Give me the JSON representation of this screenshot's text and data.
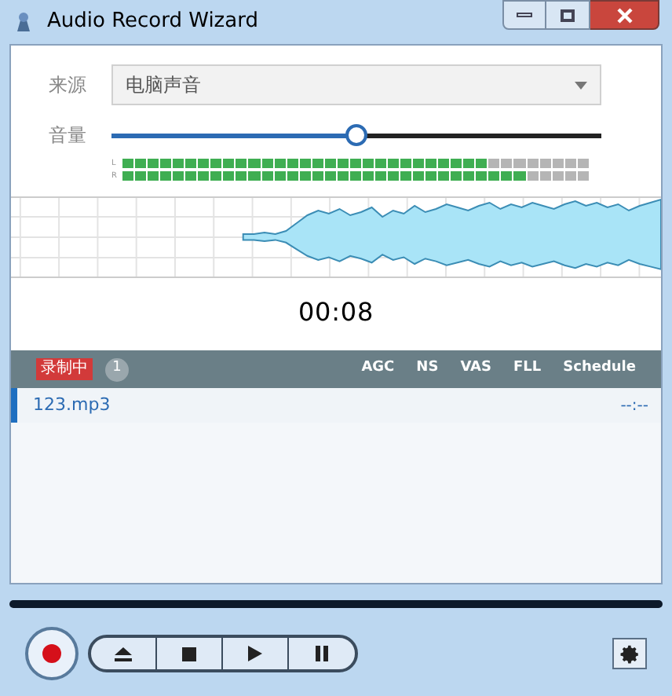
{
  "window": {
    "title": "Audio Record Wizard"
  },
  "source": {
    "label": "来源",
    "value": "电脑声音"
  },
  "volume": {
    "label": "音量",
    "level": 0.5
  },
  "meters": [
    {
      "channel": "L",
      "level": 0.78
    },
    {
      "channel": "R",
      "level": 0.86
    }
  ],
  "time": "00:08",
  "status_bar": {
    "state": "录制中",
    "count": "1",
    "options": [
      "AGC",
      "NS",
      "VAS",
      "FLL",
      "Schedule"
    ]
  },
  "files": [
    {
      "name": "123.mp3",
      "duration": "--:--",
      "selected": true
    }
  ]
}
